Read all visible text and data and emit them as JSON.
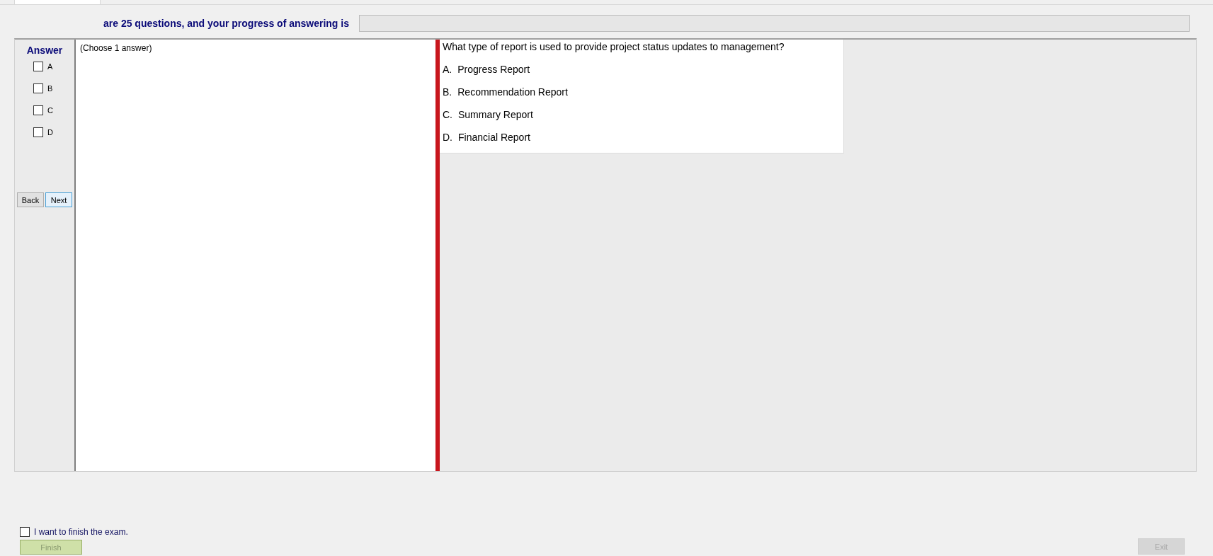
{
  "header": {
    "text": "are 25 questions, and your progress of answering is",
    "progress": {
      "level": 0
    }
  },
  "answer_panel": {
    "title": "Answer",
    "options": [
      {
        "label": "A",
        "checked": false
      },
      {
        "label": "B",
        "checked": false
      },
      {
        "label": "C",
        "checked": false
      },
      {
        "label": "D",
        "checked": false
      }
    ],
    "buttons": [
      {
        "label": "Back",
        "kind": "plain"
      },
      {
        "label": "Next",
        "kind": "focused"
      }
    ]
  },
  "instruction": "(Choose 1 answer)",
  "question": {
    "text": "What type of report is used to provide project status updates to management?",
    "choices": [
      {
        "letter": "A.",
        "text": "Progress Report"
      },
      {
        "letter": "B.",
        "text": "Recommendation Report"
      },
      {
        "letter": "C.",
        "text": "Summary Report"
      },
      {
        "letter": "D.",
        "text": "Financial Report"
      }
    ]
  },
  "finish": {
    "label": "I want to finish the exam.",
    "checked": false,
    "button": {
      "label": "Finish",
      "disabled": true
    }
  },
  "exit_button": {
    "label": "Exit",
    "disabled": true
  }
}
